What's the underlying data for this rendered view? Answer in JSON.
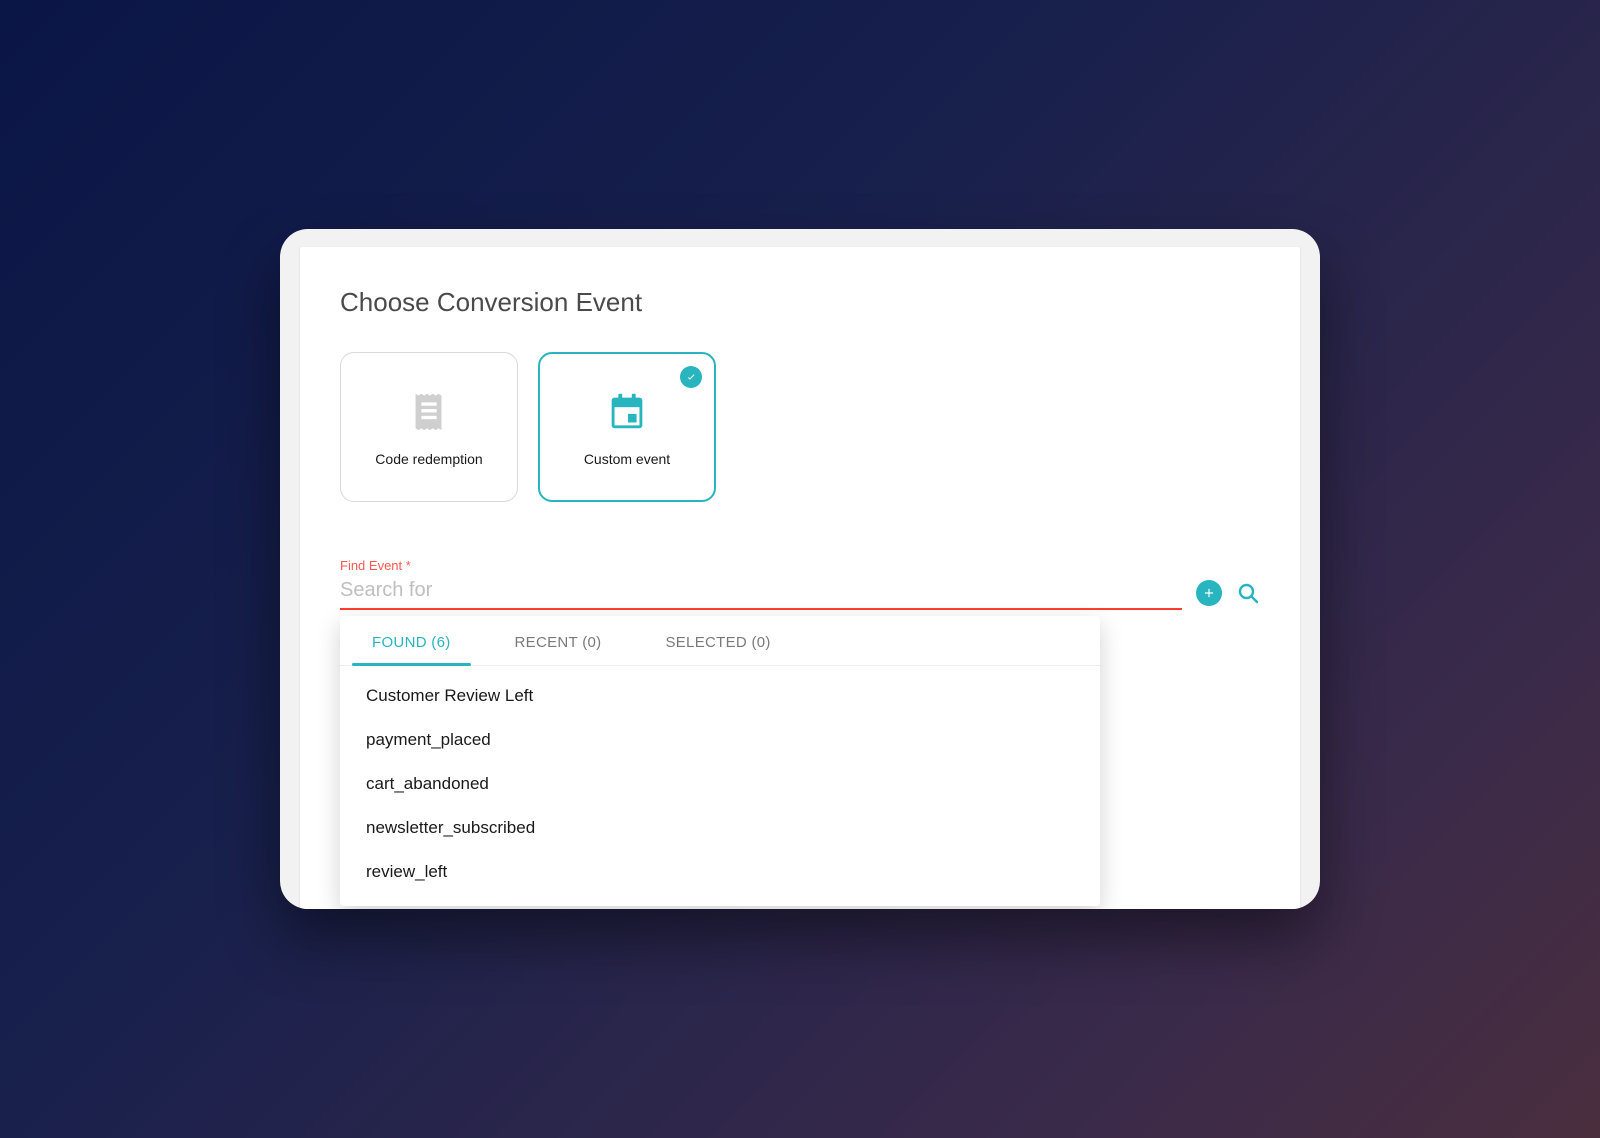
{
  "header": {
    "title": "Choose Conversion Event"
  },
  "cards": {
    "code_redemption": {
      "label": "Code redemption"
    },
    "custom_event": {
      "label": "Custom event"
    }
  },
  "search": {
    "label": "Find Event *",
    "placeholder": "Search for"
  },
  "tabs": {
    "found": {
      "label": "FOUND (6)"
    },
    "recent": {
      "label": "RECENT (0)"
    },
    "selected": {
      "label": "SELECTED (0)"
    }
  },
  "results": [
    "Customer Review Left",
    "payment_placed",
    "cart_abandoned",
    "newsletter_subscribed",
    "review_left"
  ],
  "colors": {
    "accent": "#28b5c0",
    "error": "#ff3b30"
  }
}
